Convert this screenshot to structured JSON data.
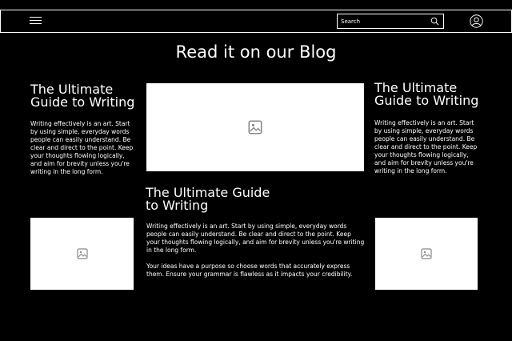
{
  "header": {
    "search_placeholder": "Search",
    "menu_icon": "hamburger-menu-icon",
    "search_icon": "search-icon",
    "user_icon": "user-account-icon"
  },
  "page": {
    "title": "Read it on our Blog"
  },
  "posts": [
    {
      "title": "The Ultimate Guide to Writing",
      "body": "Writing effectively is an art. Start by using simple, everyday words people can easily understand. Be clear and direct to the point. Keep your thoughts flowing logically, and aim for brevity unless you're writing in the long form."
    },
    {
      "title": "The Ultimate Guide to Writing",
      "body": "Writing effectively is an art. Start by using simple, everyday words people can easily understand. Be clear and direct to the point.  Keep your thoughts flowing logically, and aim for brevity unless you're writing in the long form."
    },
    {
      "title": "The Ultimate Guide to Writing",
      "body": "Writing effectively is an art. Start by using simple, everyday words people can easily understand. Be clear and direct to the point. Keep your thoughts flowing logically, and aim for brevity unless you're writing in the long form.",
      "body2": "Your ideas have a purpose so choose words that accurately express them. Ensure your grammar is flawless as it impacts your credibility."
    }
  ],
  "colors": {
    "background": "#000000",
    "foreground": "#ffffff",
    "placeholder_icon": "#888888"
  },
  "image_icon": "image-placeholder-icon"
}
